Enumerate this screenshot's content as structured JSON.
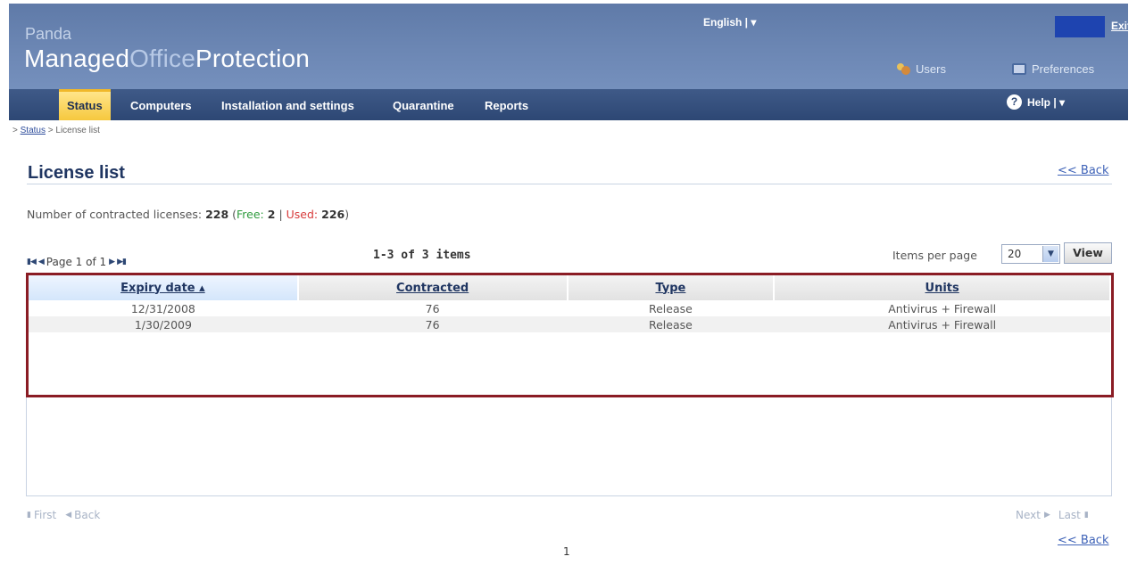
{
  "header": {
    "brand_small": "Panda",
    "brand_part1": "Managed",
    "brand_part2": "Office",
    "brand_part3": "Protection",
    "language": "English | ▾",
    "exit": "Exit",
    "users": "Users",
    "preferences": "Preferences"
  },
  "nav": {
    "items": [
      {
        "label": "Status"
      },
      {
        "label": "Computers"
      },
      {
        "label": "Installation and settings"
      },
      {
        "label": "Quarantine"
      },
      {
        "label": "Reports"
      }
    ],
    "help": "Help | ▾"
  },
  "breadcrumb": {
    "prefix": ">",
    "link": "Status",
    "current": "> License list"
  },
  "page": {
    "title": "License list",
    "back_label": "<< Back",
    "licenses_label": "Number of contracted licenses:",
    "licenses_total": "228",
    "free_label": "Free:",
    "free_value": "2",
    "used_label": "Used:",
    "used_value": "226"
  },
  "pager": {
    "page_info": "Page 1 of 1",
    "items_count": "1-3 of 3 items",
    "items_per_page_label": "Items per page",
    "items_per_page_value": "20",
    "view_button": "View",
    "first": "First",
    "back": "Back",
    "next": "Next",
    "last": "Last",
    "page_number": "1"
  },
  "table": {
    "columns": [
      "Expiry date ▴",
      "Contracted",
      "Type",
      "Units"
    ],
    "rows": [
      [
        "12/31/2008",
        "76",
        "Release",
        "Antivirus + Firewall"
      ],
      [
        "1/30/2009",
        "76",
        "Release",
        "Antivirus + Firewall"
      ]
    ]
  },
  "colors": {
    "header_blue": "#6c87b4",
    "nav_dark": "#2d4774",
    "active_tab": "#f6c83e",
    "highlight_border": "#8a1c24",
    "free_green": "#2e9b3d",
    "used_red": "#d73a3a"
  },
  "icons": [
    "users-icon",
    "preferences-icon",
    "help-icon",
    "sort-asc-icon",
    "first-page-icon",
    "prev-page-icon",
    "next-page-icon",
    "last-page-icon",
    "dropdown-arrow-icon"
  ]
}
